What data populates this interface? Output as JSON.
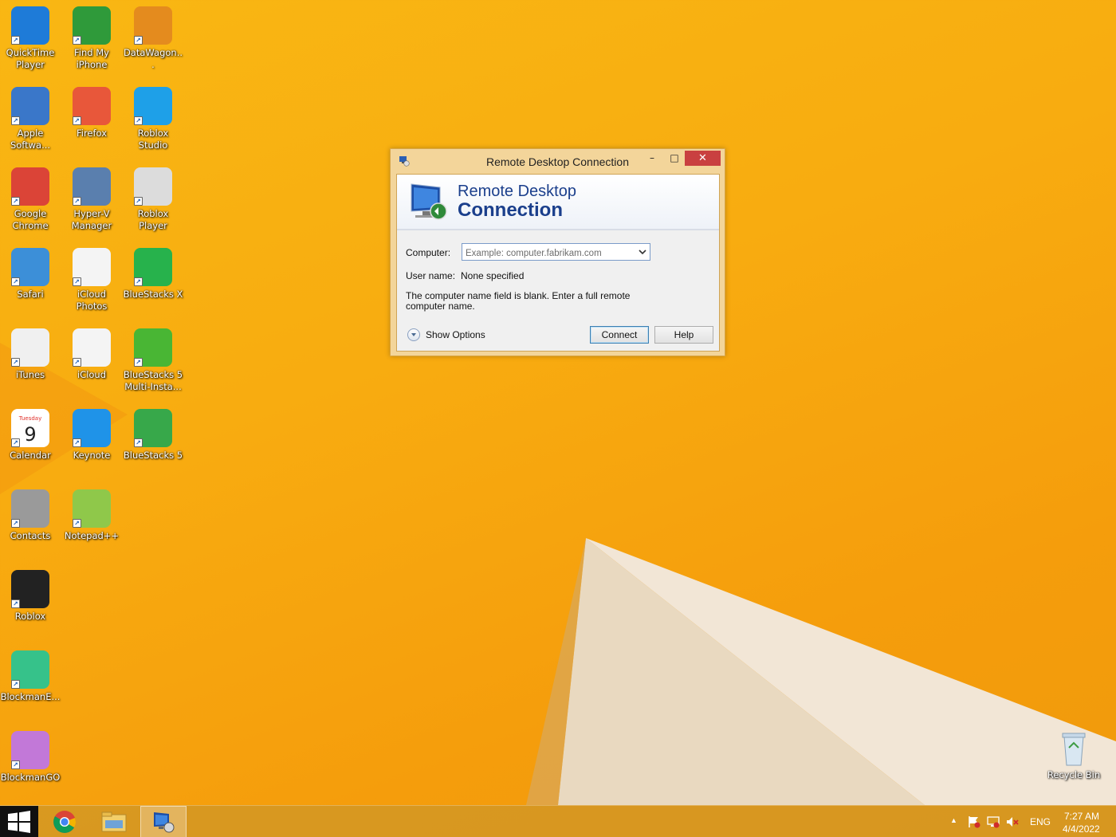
{
  "desktop": {
    "icons": [
      {
        "label": "QuickTime Player",
        "color": "#1e7bd8"
      },
      {
        "label": "Find My iPhone",
        "color": "#2f9a3a"
      },
      {
        "label": "DataWagon...",
        "color": "#e48b1e"
      },
      {
        "label": "Apple Softwa...",
        "color": "#3a77c9"
      },
      {
        "label": "Firefox",
        "color": "#e8573a"
      },
      {
        "label": "Roblox Studio",
        "color": "#1ea0e8"
      },
      {
        "label": "Google Chrome",
        "color": "#db4437"
      },
      {
        "label": "Hyper-V Manager",
        "color": "#5a7fae"
      },
      {
        "label": "Roblox Player",
        "color": "#dcdcdc"
      },
      {
        "label": "Safari",
        "color": "#3c8fd8"
      },
      {
        "label": "iCloud Photos",
        "color": "#f4f4f4"
      },
      {
        "label": "BlueStacks X",
        "color": "#27b24c"
      },
      {
        "label": "iTunes",
        "color": "#f0f0f0"
      },
      {
        "label": "iCloud",
        "color": "#f4f4f4"
      },
      {
        "label": "BlueStacks 5 Multi-Insta...",
        "color": "#49b634"
      },
      {
        "label": "Calendar",
        "color": "#ffffff",
        "day_name": "Tuesday",
        "day_num": "9"
      },
      {
        "label": "Keynote",
        "color": "#1f93e8"
      },
      {
        "label": "BlueStacks 5",
        "color": "#37a84a"
      },
      {
        "label": "Contacts",
        "color": "#9a9a9a"
      },
      {
        "label": "Notepad++",
        "color": "#8fc84a"
      },
      {
        "label": "Roblox",
        "color": "#222222"
      },
      {
        "label": "BlockmanE...",
        "color": "#36c28a"
      },
      {
        "label": "BlockmanGO",
        "color": "#c278d8"
      }
    ],
    "recycle_bin_label": "Recycle Bin"
  },
  "dialog": {
    "title": "Remote Desktop Connection",
    "banner_line1": "Remote Desktop",
    "banner_line2": "Connection",
    "computer_label": "Computer:",
    "computer_placeholder": "Example: computer.fabrikam.com",
    "username_label": "User name:",
    "username_value": "None specified",
    "message": "The computer name field is blank. Enter a full remote computer name.",
    "show_options": "Show Options",
    "connect_label": "Connect",
    "help_label": "Help",
    "minimize": "–",
    "maximize": "□",
    "close": "✕"
  },
  "taskbar": {
    "language": "ENG",
    "time": "7:27 AM",
    "date": "4/4/2022",
    "tray_arrow": "▲"
  }
}
